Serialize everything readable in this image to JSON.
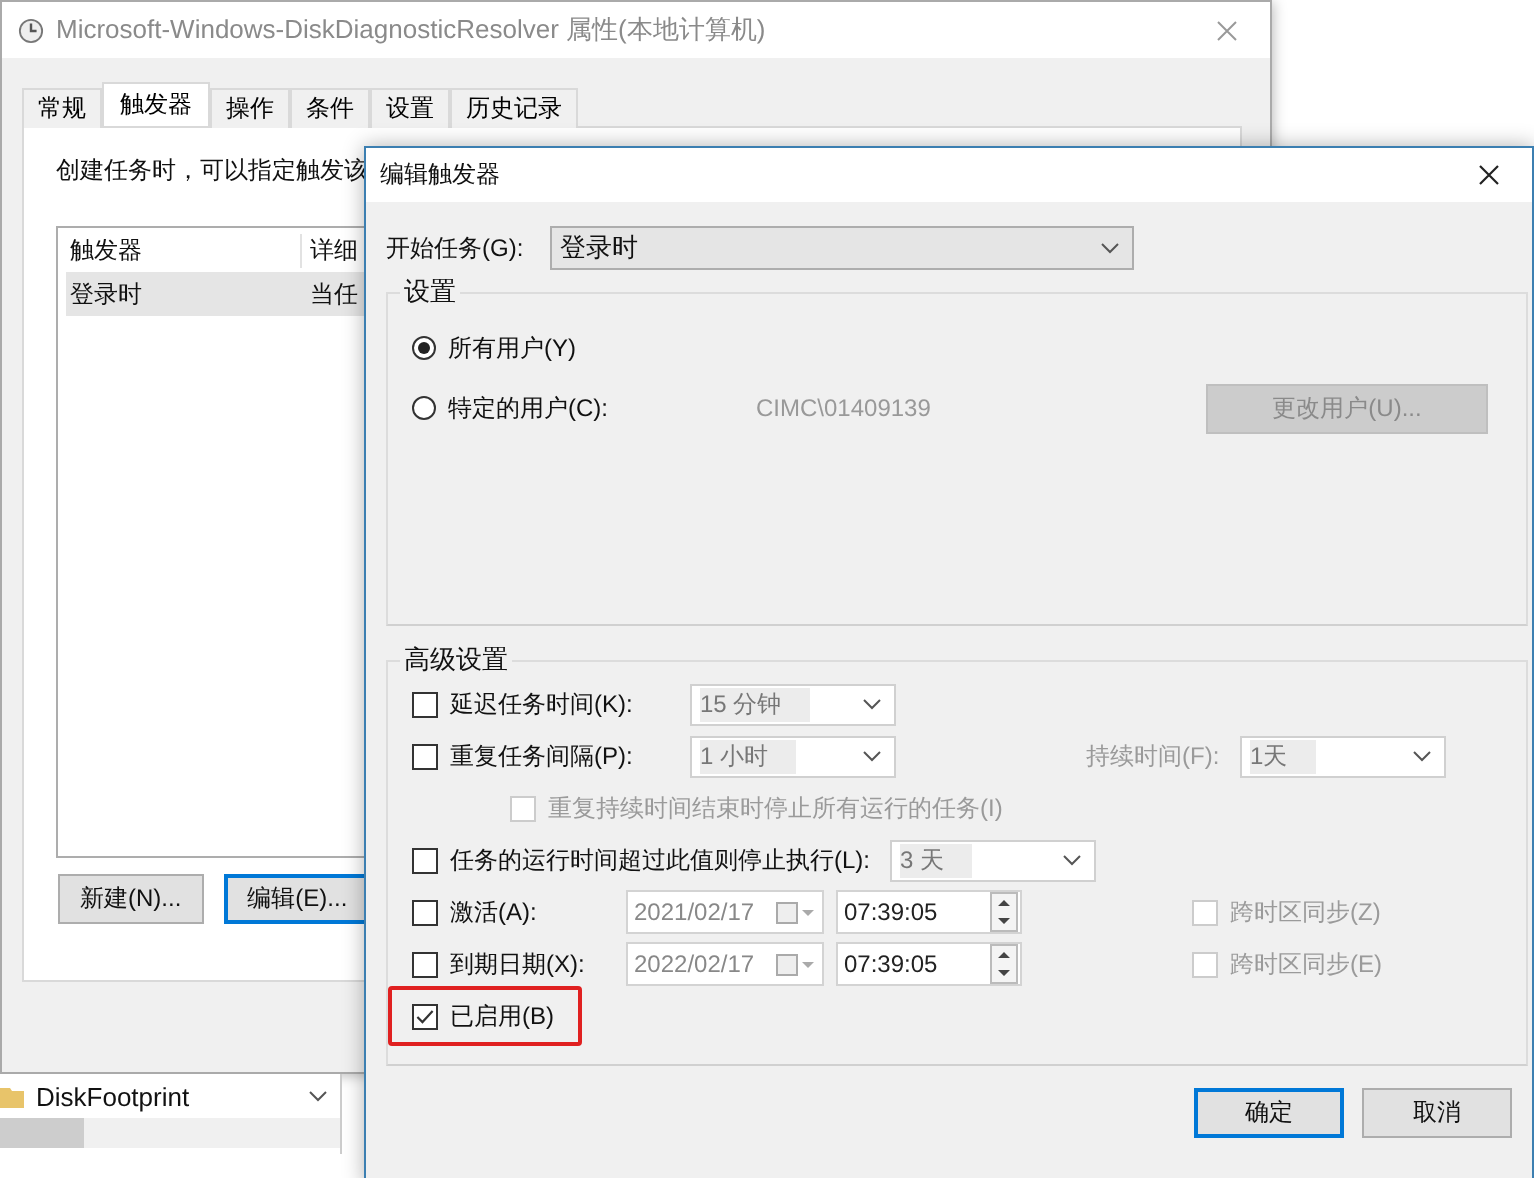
{
  "main_window": {
    "title": "Microsoft-Windows-DiskDiagnosticResolver 属性(本地计算机)",
    "tabs": [
      {
        "label": "常规",
        "selected": false
      },
      {
        "label": "触发器",
        "selected": true
      },
      {
        "label": "操作",
        "selected": false
      },
      {
        "label": "条件",
        "selected": false
      },
      {
        "label": "设置",
        "selected": false
      },
      {
        "label": "历史记录",
        "selected": false
      }
    ],
    "description": "创建任务时，可以指定触发该",
    "trigger_list": {
      "columns": [
        "触发器",
        "详细"
      ],
      "rows": [
        {
          "cells": [
            "登录时",
            "当任"
          ],
          "selected": true
        }
      ]
    },
    "buttons": [
      {
        "label": "新建(N)...",
        "focused": false
      },
      {
        "label": "编辑(E)...",
        "focused": true
      }
    ]
  },
  "tree_behind": {
    "item": "DiskFootprint"
  },
  "dialog": {
    "title": "编辑触发器",
    "begin_task": {
      "label": "开始任务(G):",
      "value": "登录时"
    },
    "settings": {
      "legend": "设置",
      "options": [
        {
          "label": "所有用户(Y)",
          "selected": true
        },
        {
          "label": "特定的用户(C):",
          "selected": false
        }
      ],
      "user": "CIMC\\01409139",
      "change_user_button": {
        "label": "更改用户(U)...",
        "disabled": true
      }
    },
    "advanced": {
      "legend": "高级设置",
      "rows": [
        {
          "kind": "select",
          "label": "延迟任务时间(K):",
          "checked": false,
          "value": "15 分钟"
        },
        {
          "kind": "select",
          "label": "重复任务间隔(P):",
          "checked": false,
          "value": "1 小时",
          "extra_label": "持续时间(F):",
          "extra_value": "1天"
        },
        {
          "kind": "sub",
          "label": "重复持续时间结束时停止所有运行的任务(I)",
          "checked": false,
          "disabled": true
        },
        {
          "kind": "select",
          "label": "任务的运行时间超过此值则停止执行(L):",
          "checked": false,
          "value": "3 天"
        },
        {
          "kind": "datetime",
          "label": "激活(A):",
          "checked": false,
          "date": "2021/02/17",
          "time": "07:39:05",
          "sync_label": "跨时区同步(Z)",
          "sync_checked": false
        },
        {
          "kind": "datetime",
          "label": "到期日期(X):",
          "checked": false,
          "date": "2022/02/17",
          "time": "07:39:05",
          "sync_label": "跨时区同步(E)",
          "sync_checked": false
        },
        {
          "kind": "check",
          "label": "已启用(B)",
          "checked": true,
          "highlighted": true
        }
      ]
    },
    "buttons": [
      {
        "label": "确定",
        "focused": true
      },
      {
        "label": "取消",
        "focused": false
      }
    ]
  }
}
